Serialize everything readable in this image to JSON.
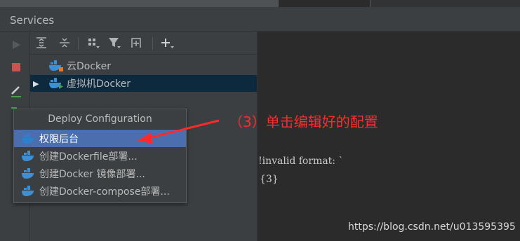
{
  "panel": {
    "title": "Services"
  },
  "tree": {
    "items": [
      {
        "label": "云Docker",
        "expanded": false,
        "selected": false,
        "icon": "docker-icon"
      },
      {
        "label": "虚拟机Docker",
        "expanded": false,
        "selected": true,
        "icon": "docker-icon"
      }
    ]
  },
  "popup": {
    "title": "Deploy Configuration",
    "items": [
      {
        "label": "权限后台",
        "selected": true,
        "icon": "docker-icon"
      },
      {
        "label": "创建Dockerfile部署...",
        "selected": false,
        "icon": "docker-icon"
      },
      {
        "label": "创建Docker 镜像部署...",
        "selected": false,
        "icon": "docker-icon"
      },
      {
        "label": "创建Docker-compose部署...",
        "selected": false,
        "icon": "docker-icon"
      }
    ]
  },
  "annotation": {
    "text": "（3）单击编辑好的配置",
    "color": "#ff2a2a"
  },
  "error": {
    "line1": "!invalid format: `",
    "line2": "{3}"
  },
  "watermark": "https://blog.csdn.net/u013595395",
  "colors": {
    "selection_blue": "#4b6eaf",
    "tree_selected": "#0d293e",
    "stop_red": "#c75450",
    "run_green": "#499c54",
    "docker_blue": "#3d8fd6"
  }
}
